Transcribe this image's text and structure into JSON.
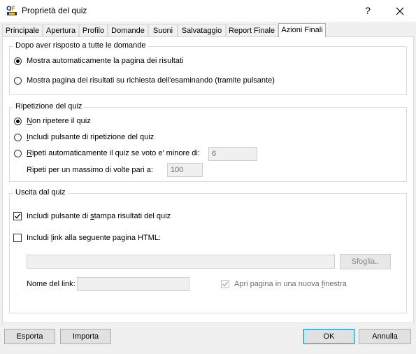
{
  "window": {
    "title": "Proprietà del quiz",
    "help_symbol": "?",
    "close_symbol": "✕"
  },
  "tabs": [
    {
      "label": "Principale"
    },
    {
      "label": "Apertura"
    },
    {
      "label": "Profilo"
    },
    {
      "label": "Domande"
    },
    {
      "label": "Suoni"
    },
    {
      "label": "Salvataggio"
    },
    {
      "label": "Report Finale"
    },
    {
      "label": "Azioni Finali",
      "active": true
    }
  ],
  "group_risposto": {
    "title": "Dopo aver risposto a tutte le domande",
    "opt_auto": {
      "label": "Mostra automaticamente la pagina dei risultati",
      "selected": true
    },
    "opt_richiesta": {
      "label": "Mostra pagina dei risultati su richiesta dell'esaminando (tramite pulsante)",
      "selected": false
    }
  },
  "group_ripetizione": {
    "title": "Ripetizione del quiz",
    "opt_non": {
      "label_pre": "N",
      "label_post": "on ripetere il quiz",
      "selected": true
    },
    "opt_pulsante": {
      "label_pre": "I",
      "label_post": "ncludi pulsante di ripetizione del quiz",
      "selected": false
    },
    "opt_auto": {
      "label_pre": "R",
      "label_post": "ipeti automaticamente il quiz se voto e' minore di:",
      "selected": false
    },
    "soglia_value": "6",
    "max_label": "Ripeti per un massimo di volte pari a:",
    "max_value": "100"
  },
  "group_uscita": {
    "title": "Uscita dal quiz",
    "stampa": {
      "label_pre": "Includi pulsante di ",
      "label_ul": "s",
      "label_post": "tampa risultati del quiz",
      "checked": true
    },
    "link": {
      "label_pre": "Includi ",
      "label_ul": "l",
      "label_post": "ink alla seguente pagina HTML:",
      "checked": false
    },
    "html_path_value": "",
    "sfoglia_label": "Sfoglia..",
    "nome_link_label": "Nome del link:",
    "nome_link_value": "",
    "nuova_finestra": {
      "label_pre": "Apri pagina in una nuova ",
      "label_ul": "f",
      "label_post": "inestra",
      "checked": true
    }
  },
  "footer": {
    "esporta": "Esporta",
    "importa": "Importa",
    "ok": "OK",
    "annulla": "Annulla"
  },
  "colors": {
    "accent": "#0078d7",
    "panel_bg": "#ffffff",
    "dialog_bg": "#f0f0f0"
  }
}
